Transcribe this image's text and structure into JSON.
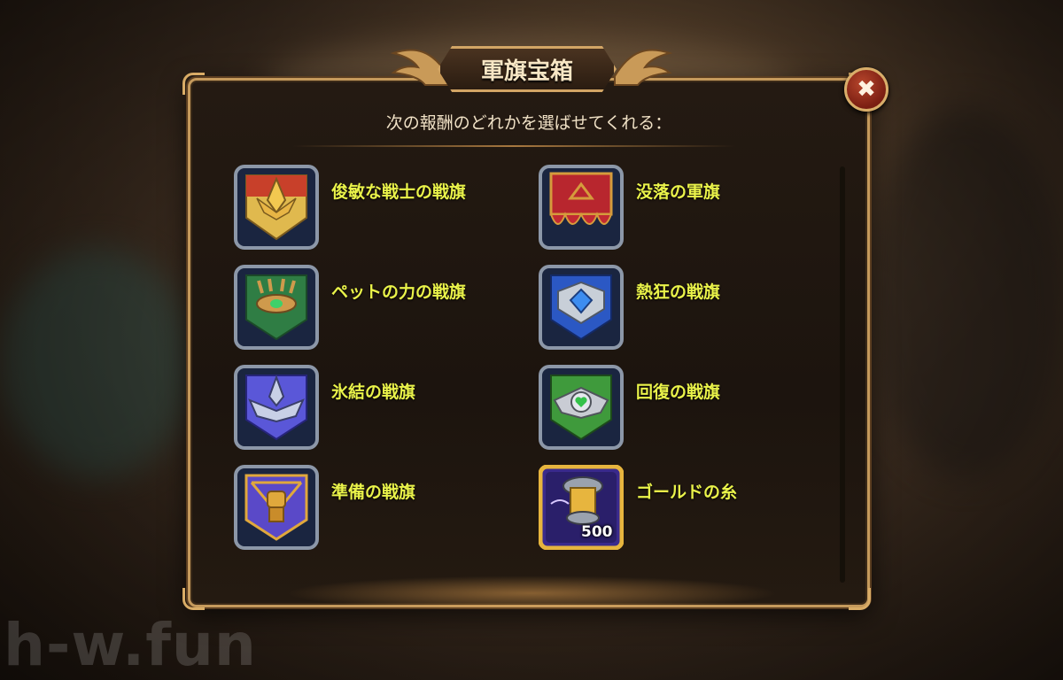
{
  "dialog": {
    "title": "軍旗宝箱",
    "subtitle": "次の報酬のどれかを選ばせてくれる："
  },
  "watermark": "h-w.fun",
  "items": [
    {
      "label": "俊敏な戦士の戦旗",
      "icon": "agile-warrior-banner-icon",
      "colors": {
        "banner": "#c8402a",
        "trim": "#e8b545"
      }
    },
    {
      "label": "没落の軍旗",
      "icon": "fallen-banner-icon",
      "colors": {
        "banner": "#b8262e",
        "trim": "#d59b3c"
      }
    },
    {
      "label": "ペットの力の戦旗",
      "icon": "pet-power-banner-icon",
      "colors": {
        "banner": "#2f7d44",
        "trim": "#cf9a4c"
      }
    },
    {
      "label": "熱狂の戦旗",
      "icon": "frenzy-banner-icon",
      "colors": {
        "banner": "#2b58c4",
        "trim": "#c8cfd8"
      }
    },
    {
      "label": "氷結の戦旗",
      "icon": "freeze-banner-icon",
      "colors": {
        "banner": "#5a57d8",
        "trim": "#c8d0e6"
      }
    },
    {
      "label": "回復の戦旗",
      "icon": "healing-banner-icon",
      "colors": {
        "banner": "#3f9a3c",
        "trim": "#c9ccd4"
      }
    },
    {
      "label": "準備の戦旗",
      "icon": "preparation-banner-icon",
      "colors": {
        "banner": "#5a49c8",
        "trim": "#e0a83c"
      }
    },
    {
      "label": "ゴールドの糸",
      "icon": "gold-thread-icon",
      "quantity": "500",
      "colors": {
        "banner": "#3a2a8c",
        "trim": "#e7b53e"
      }
    }
  ]
}
